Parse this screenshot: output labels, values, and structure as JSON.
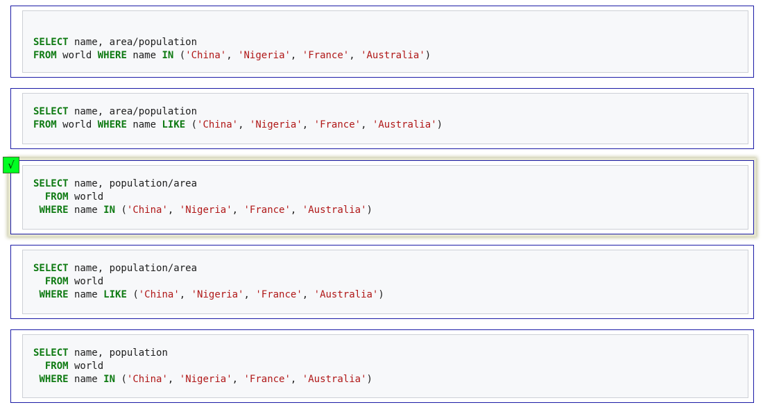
{
  "options": [
    {
      "lines": [
        [
          {
            "t": "kw",
            "v": "SELECT"
          },
          {
            "t": "p",
            "v": " name, area/population"
          }
        ],
        [
          {
            "t": "kw",
            "v": "FROM"
          },
          {
            "t": "p",
            "v": " world "
          },
          {
            "t": "kw",
            "v": "WHERE"
          },
          {
            "t": "p",
            "v": " name "
          },
          {
            "t": "kw",
            "v": "IN"
          },
          {
            "t": "p",
            "v": " ("
          },
          {
            "t": "str",
            "v": "'China'"
          },
          {
            "t": "p",
            "v": ", "
          },
          {
            "t": "str",
            "v": "'Nigeria'"
          },
          {
            "t": "p",
            "v": ", "
          },
          {
            "t": "str",
            "v": "'France'"
          },
          {
            "t": "p",
            "v": ", "
          },
          {
            "t": "str",
            "v": "'Australia'"
          },
          {
            "t": "p",
            "v": ")"
          }
        ]
      ],
      "selected": false
    },
    {
      "lines": [
        [
          {
            "t": "kw",
            "v": "SELECT"
          },
          {
            "t": "p",
            "v": " name, area/population"
          }
        ],
        [
          {
            "t": "kw",
            "v": "FROM"
          },
          {
            "t": "p",
            "v": " world "
          },
          {
            "t": "kw",
            "v": "WHERE"
          },
          {
            "t": "p",
            "v": " name "
          },
          {
            "t": "kw",
            "v": "LIKE"
          },
          {
            "t": "p",
            "v": " ("
          },
          {
            "t": "str",
            "v": "'China'"
          },
          {
            "t": "p",
            "v": ", "
          },
          {
            "t": "str",
            "v": "'Nigeria'"
          },
          {
            "t": "p",
            "v": ", "
          },
          {
            "t": "str",
            "v": "'France'"
          },
          {
            "t": "p",
            "v": ", "
          },
          {
            "t": "str",
            "v": "'Australia'"
          },
          {
            "t": "p",
            "v": ")"
          }
        ]
      ],
      "selected": false
    },
    {
      "lines": [
        [
          {
            "t": "kw",
            "v": "SELECT"
          },
          {
            "t": "p",
            "v": " name, population/area"
          }
        ],
        [
          {
            "t": "p",
            "v": "  "
          },
          {
            "t": "kw",
            "v": "FROM"
          },
          {
            "t": "p",
            "v": " world"
          }
        ],
        [
          {
            "t": "p",
            "v": " "
          },
          {
            "t": "kw",
            "v": "WHERE"
          },
          {
            "t": "p",
            "v": " name "
          },
          {
            "t": "kw",
            "v": "IN"
          },
          {
            "t": "p",
            "v": " ("
          },
          {
            "t": "str",
            "v": "'China'"
          },
          {
            "t": "p",
            "v": ", "
          },
          {
            "t": "str",
            "v": "'Nigeria'"
          },
          {
            "t": "p",
            "v": ", "
          },
          {
            "t": "str",
            "v": "'France'"
          },
          {
            "t": "p",
            "v": ", "
          },
          {
            "t": "str",
            "v": "'Australia'"
          },
          {
            "t": "p",
            "v": ")"
          }
        ]
      ],
      "selected": true,
      "check_mark": "√"
    },
    {
      "lines": [
        [
          {
            "t": "kw",
            "v": "SELECT"
          },
          {
            "t": "p",
            "v": " name, population/area"
          }
        ],
        [
          {
            "t": "p",
            "v": "  "
          },
          {
            "t": "kw",
            "v": "FROM"
          },
          {
            "t": "p",
            "v": " world"
          }
        ],
        [
          {
            "t": "p",
            "v": " "
          },
          {
            "t": "kw",
            "v": "WHERE"
          },
          {
            "t": "p",
            "v": " name "
          },
          {
            "t": "kw",
            "v": "LIKE"
          },
          {
            "t": "p",
            "v": " ("
          },
          {
            "t": "str",
            "v": "'China'"
          },
          {
            "t": "p",
            "v": ", "
          },
          {
            "t": "str",
            "v": "'Nigeria'"
          },
          {
            "t": "p",
            "v": ", "
          },
          {
            "t": "str",
            "v": "'France'"
          },
          {
            "t": "p",
            "v": ", "
          },
          {
            "t": "str",
            "v": "'Australia'"
          },
          {
            "t": "p",
            "v": ")"
          }
        ]
      ],
      "selected": false
    },
    {
      "lines": [
        [
          {
            "t": "kw",
            "v": "SELECT"
          },
          {
            "t": "p",
            "v": " name, population"
          }
        ],
        [
          {
            "t": "p",
            "v": "  "
          },
          {
            "t": "kw",
            "v": "FROM"
          },
          {
            "t": "p",
            "v": " world"
          }
        ],
        [
          {
            "t": "p",
            "v": " "
          },
          {
            "t": "kw",
            "v": "WHERE"
          },
          {
            "t": "p",
            "v": " name "
          },
          {
            "t": "kw",
            "v": "IN"
          },
          {
            "t": "p",
            "v": " ("
          },
          {
            "t": "str",
            "v": "'China'"
          },
          {
            "t": "p",
            "v": ", "
          },
          {
            "t": "str",
            "v": "'Nigeria'"
          },
          {
            "t": "p",
            "v": ", "
          },
          {
            "t": "str",
            "v": "'France'"
          },
          {
            "t": "p",
            "v": ", "
          },
          {
            "t": "str",
            "v": "'Australia'"
          },
          {
            "t": "p",
            "v": ")"
          }
        ]
      ],
      "selected": false
    }
  ]
}
